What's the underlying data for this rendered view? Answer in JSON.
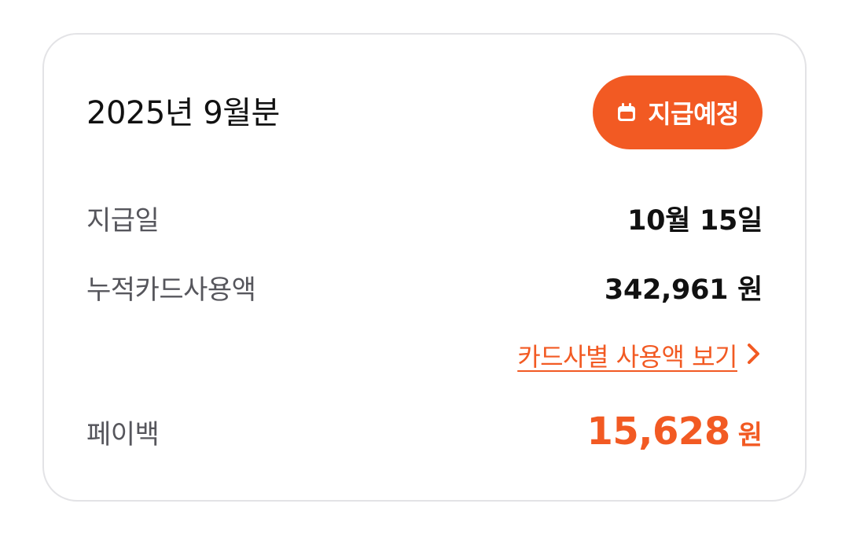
{
  "card": {
    "period_title": "2025년 9월분",
    "status_badge": {
      "label": "지급예정",
      "icon": "calendar-icon",
      "color": "#F25A23"
    },
    "rows": {
      "payment_date": {
        "label": "지급일",
        "value": "10월 15일"
      },
      "card_usage": {
        "label": "누적카드사용액",
        "value": "342,961 원"
      },
      "payback": {
        "label": "페이백",
        "amount": "15,628",
        "unit": "원"
      }
    },
    "card_usage_link": {
      "label": "카드사별 사용액 보기",
      "icon": "chevron-right-icon"
    }
  },
  "colors": {
    "accent": "#F25A23",
    "border": "#E3E3E6",
    "label_text": "#56565C",
    "value_text": "#111111"
  }
}
